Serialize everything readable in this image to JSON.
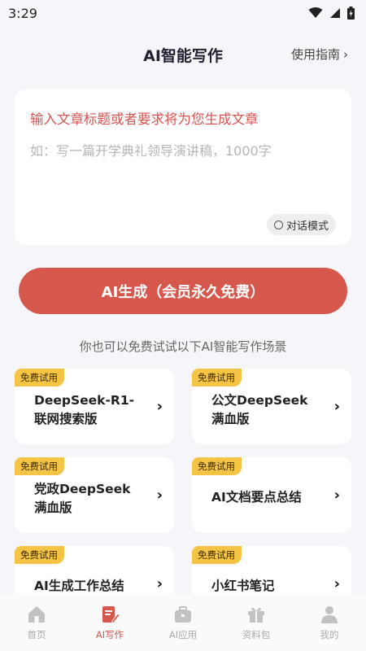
{
  "status": {
    "time": "3:29"
  },
  "header": {
    "title": "AI智能写作",
    "guide": "使用指南",
    "guide_arrow": "›"
  },
  "input": {
    "prompt": "输入文章标题或者要求将为您生成文章",
    "placeholder": "如：写一篇开学典礼领导演讲稿，1000字",
    "chat_mode": "对话模式"
  },
  "generate_button": "AI生成（会员永久免费）",
  "hint": "你也可以免费试试以下AI智能写作场景",
  "cards": [
    {
      "tag": "免费试用",
      "lines": [
        "DeepSeek-R1-",
        "联网搜索版"
      ],
      "arrow": "›"
    },
    {
      "tag": "免费试用",
      "lines": [
        "公文DeepSeek",
        "满血版"
      ],
      "arrow": "›"
    },
    {
      "tag": "免费试用",
      "lines": [
        "党政DeepSeek",
        "满血版"
      ],
      "arrow": "›"
    },
    {
      "tag": "免费试用",
      "lines": [
        "AI文档要点总结"
      ],
      "arrow": "›"
    },
    {
      "tag": "免费试用",
      "lines": [
        "AI生成工作总结"
      ],
      "arrow": "›"
    },
    {
      "tag": "免费试用",
      "lines": [
        "小红书笔记"
      ],
      "arrow": "›"
    }
  ],
  "tabs": [
    {
      "label": "首页",
      "icon": "home-icon"
    },
    {
      "label": "AI写作",
      "icon": "write-icon"
    },
    {
      "label": "AI应用",
      "icon": "toolbox-icon"
    },
    {
      "label": "资料包",
      "icon": "gift-icon"
    },
    {
      "label": "我的",
      "icon": "person-icon"
    }
  ],
  "colors": {
    "accent": "#d6584d",
    "tag": "#f6c445",
    "background": "#f5f5fa"
  }
}
